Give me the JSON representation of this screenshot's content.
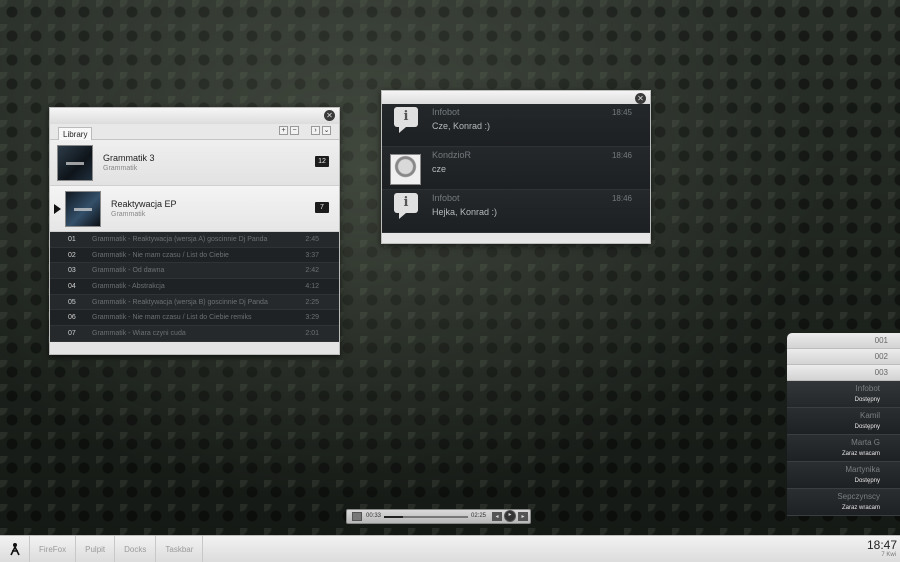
{
  "library": {
    "tab": "Library",
    "buttons": [
      "+",
      "−",
      "›",
      "⌄"
    ],
    "albums": [
      {
        "title": "Grammatik 3",
        "artist": "Grammatik",
        "count": "12"
      },
      {
        "title": "Reaktywacja EP",
        "artist": "Grammatik",
        "count": "7"
      }
    ],
    "tracks": [
      {
        "num": "01",
        "name": "Grammatik - Reaktywacja (wersja A) goscinnie Dj Panda",
        "dur": "2:45"
      },
      {
        "num": "02",
        "name": "Grammatik - Nie mam czasu / List do Ciebie",
        "dur": "3:37"
      },
      {
        "num": "03",
        "name": "Grammatik - Od dawna",
        "dur": "2:42"
      },
      {
        "num": "04",
        "name": "Grammatik - Abstrakcja",
        "dur": "4:12"
      },
      {
        "num": "05",
        "name": "Grammatik - Reaktywacja (wersja B) goscinnie Dj Panda",
        "dur": "2:25"
      },
      {
        "num": "06",
        "name": "Grammatik - Nie mam czasu / List do Ciebie remiks",
        "dur": "3:29"
      },
      {
        "num": "07",
        "name": "Grammatik - Wiara czyni cuda",
        "dur": "2:01"
      }
    ]
  },
  "notifications": [
    {
      "sender": "Infobot",
      "message": "Cze, Konrad :)",
      "time": "18:45",
      "avatar": "info-icon"
    },
    {
      "sender": "KondzioR",
      "message": "cze",
      "time": "18:46",
      "avatar": "user-photo"
    },
    {
      "sender": "Infobot",
      "message": "Hejka, Konrad :)",
      "time": "18:46",
      "avatar": "info-icon"
    }
  ],
  "player": {
    "current": "00:33",
    "total": "02:25",
    "progress": 0.23
  },
  "side_panel": {
    "groups": [
      "001",
      "002",
      "003"
    ],
    "contacts": [
      {
        "name": "Infobot",
        "status": "Dostępny"
      },
      {
        "name": "Kamil",
        "status": "Dostępny"
      },
      {
        "name": "Marta G",
        "status": "Zaraz wracam"
      },
      {
        "name": "Martynika",
        "status": "Dostępny"
      },
      {
        "name": "Sepczynscy",
        "status": "Zaraz wracam"
      }
    ]
  },
  "taskbar": {
    "items": [
      "FireFox",
      "Pulpit",
      "Docks",
      "Taskbar"
    ],
    "clock": "18:47",
    "date": "7 Kwi"
  },
  "colors": {
    "panel_light": "#e4e4e4",
    "panel_dark": "#1f2224",
    "accent_dark": "#1c1c1c"
  }
}
